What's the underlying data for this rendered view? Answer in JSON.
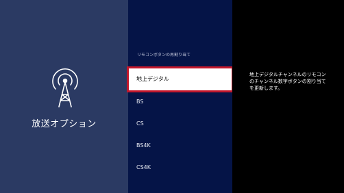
{
  "left": {
    "icon": "broadcast-antenna-icon",
    "title": "放送オプション"
  },
  "menu": {
    "header": "リモコンボタンの再割り当て",
    "items": [
      {
        "label": "地上デジタル",
        "selected": true
      },
      {
        "label": "BS",
        "selected": false
      },
      {
        "label": "CS",
        "selected": false
      },
      {
        "label": "BS4K",
        "selected": false
      },
      {
        "label": "CS4K",
        "selected": false
      }
    ]
  },
  "description": "地上デジタルチャンネルのリモコンのチャンネル数字ボタンの割り当てを更新します。",
  "colors": {
    "left_panel": "#2b3a63",
    "mid_panel": "#051447",
    "focus_border": "#c3172b",
    "background": "#000000"
  }
}
